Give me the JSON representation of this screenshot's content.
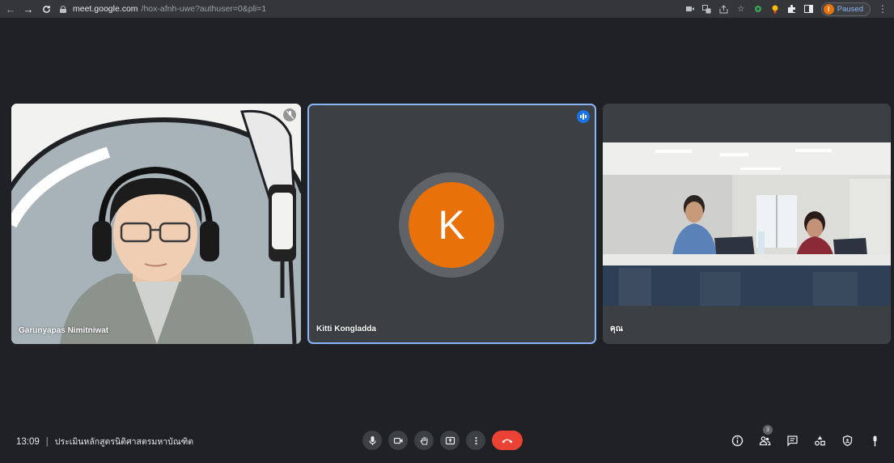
{
  "browser": {
    "url_host": "meet.google.com",
    "url_path": "/hox-afnh-uwe?authuser=0&pli=1",
    "profile_initial": "I",
    "profile_status": "Paused",
    "nav_back": "←",
    "nav_forward": "→",
    "reload": "C"
  },
  "participants": [
    {
      "name": "Garunyapas Nimitniwat",
      "mic": "muted"
    },
    {
      "name": "Kitti Kongladda",
      "avatar_letter": "K",
      "avatar_color": "#e8710a",
      "speaking": true
    },
    {
      "name": "คุณ"
    }
  ],
  "meeting": {
    "time": "13:09",
    "separator": "|",
    "title": "ประเมินหลักสูตรนิติศาสตรมหาบัณฑิต"
  },
  "side_panel": {
    "people_count": "3"
  },
  "colors": {
    "background": "#202124",
    "tile": "#3c4043",
    "active_border": "#8ab4f8",
    "end_call": "#ea4335",
    "avatar": "#e8710a"
  }
}
